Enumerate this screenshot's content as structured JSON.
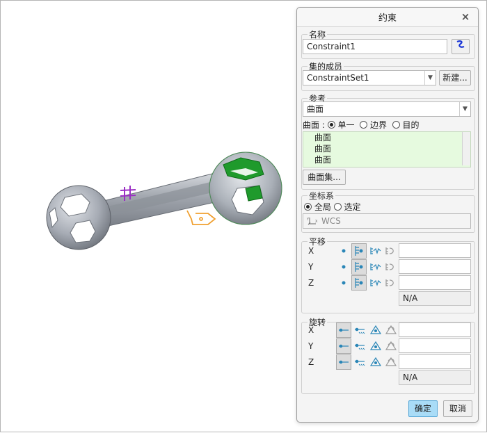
{
  "dialog": {
    "title": "约束",
    "close_glyph": "×",
    "name_section": {
      "legend": "名称",
      "value": "Constraint1",
      "pick_icon": "select-curve-icon"
    },
    "set_section": {
      "legend": "集的成员",
      "value": "ConstraintSet1",
      "new_button": "新建..."
    },
    "ref_section": {
      "legend": "参考",
      "type_value": "曲面",
      "mode_label": "曲面 :",
      "modes": [
        "单一",
        "边界",
        "目的"
      ],
      "mode_selected": 0,
      "items": [
        "曲面",
        "曲面",
        "曲面"
      ],
      "surface_set_button": "曲面集..."
    },
    "csys_section": {
      "legend": "坐标系",
      "options": [
        "全局",
        "选定"
      ],
      "selected": 0,
      "value": "WCS"
    },
    "translation_section": {
      "legend": "平移",
      "axes": [
        "X",
        "Y",
        "Z"
      ],
      "na_value": "N/A"
    },
    "rotation_section": {
      "legend": "旋转",
      "axes": [
        "X",
        "Y",
        "Z"
      ],
      "na_value": "N/A"
    },
    "ok_button": "确定",
    "cancel_button": "取消"
  },
  "colors": {
    "accent_ok": "#a9dcf7",
    "list_bg": "#e6fadf",
    "model_grey": "#a8adb6",
    "highlight_green": "#1f9a2c",
    "constraint_purple": "#9b2fc4",
    "tag_orange": "#f0a030"
  }
}
